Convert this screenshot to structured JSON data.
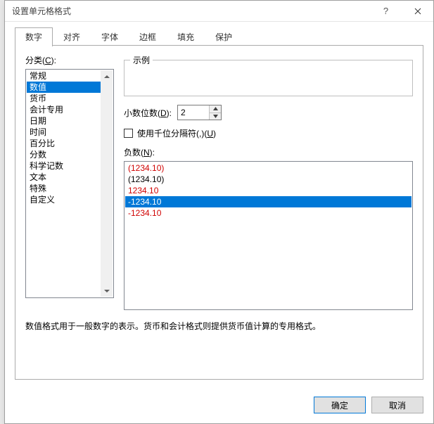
{
  "title": "设置单元格格式",
  "titlebar": {
    "help": "?"
  },
  "tabs": [
    "数字",
    "对齐",
    "字体",
    "边框",
    "填充",
    "保护"
  ],
  "activeTab": 0,
  "category": {
    "label_pre": "分类(",
    "label_key": "C",
    "label_post": "):",
    "items": [
      "常规",
      "数值",
      "货币",
      "会计专用",
      "日期",
      "时间",
      "百分比",
      "分数",
      "科学记数",
      "文本",
      "特殊",
      "自定义"
    ],
    "selectedIndex": 1
  },
  "sample": {
    "legend": "示例",
    "value": ""
  },
  "decimal": {
    "label_pre": "小数位数(",
    "label_key": "D",
    "label_post": "):",
    "value": "2"
  },
  "thousands": {
    "label_pre": "使用千位分隔符(,)(",
    "label_key": "U",
    "label_post": ")",
    "checked": false
  },
  "negative": {
    "label_pre": "负数(",
    "label_key": "N",
    "label_post": "):",
    "items": [
      {
        "text": "(1234.10)",
        "red": true
      },
      {
        "text": "(1234.10)",
        "red": false
      },
      {
        "text": "1234.10",
        "red": true
      },
      {
        "text": "-1234.10",
        "red": false
      },
      {
        "text": "-1234.10",
        "red": true
      }
    ],
    "selectedIndex": 3
  },
  "description": "数值格式用于一般数字的表示。货币和会计格式则提供货币值计算的专用格式。",
  "buttons": {
    "ok": "确定",
    "cancel": "取消"
  }
}
